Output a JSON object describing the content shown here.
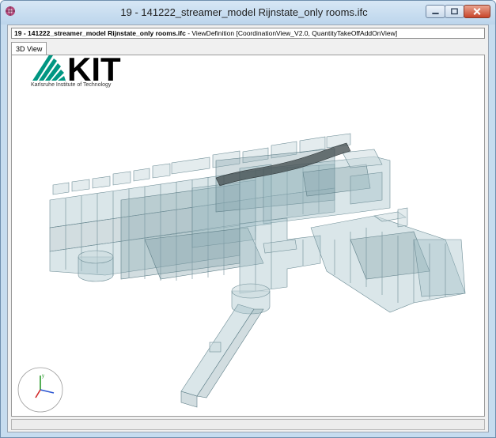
{
  "window": {
    "title": "19 - 141222_streamer_model Rijnstate_only rooms.ifc"
  },
  "definition_bar": {
    "file_name": "19 - 141222_streamer_model Rijnstate_only rooms.ifc",
    "view_definition": " - ViewDefinition [CoordinationView_V2.0, QuantityTakeOffAddOnView]"
  },
  "tabs": [
    {
      "label": "3D View",
      "active": true
    }
  ],
  "logo": {
    "wordmark": "KIT",
    "subtitle": "Karlsruhe Institute of Technology",
    "color": "#009682"
  },
  "colors": {
    "room_fill": "#9fbcc4",
    "room_stroke": "#6f8e97",
    "corridor_dark": "#454f52",
    "close_button": "#c8452a"
  },
  "icons": {
    "app": "ifc-app-icon",
    "minimize": "minimize-icon",
    "maximize": "maximize-icon",
    "close": "close-icon",
    "axes": "axis-triad-icon"
  }
}
